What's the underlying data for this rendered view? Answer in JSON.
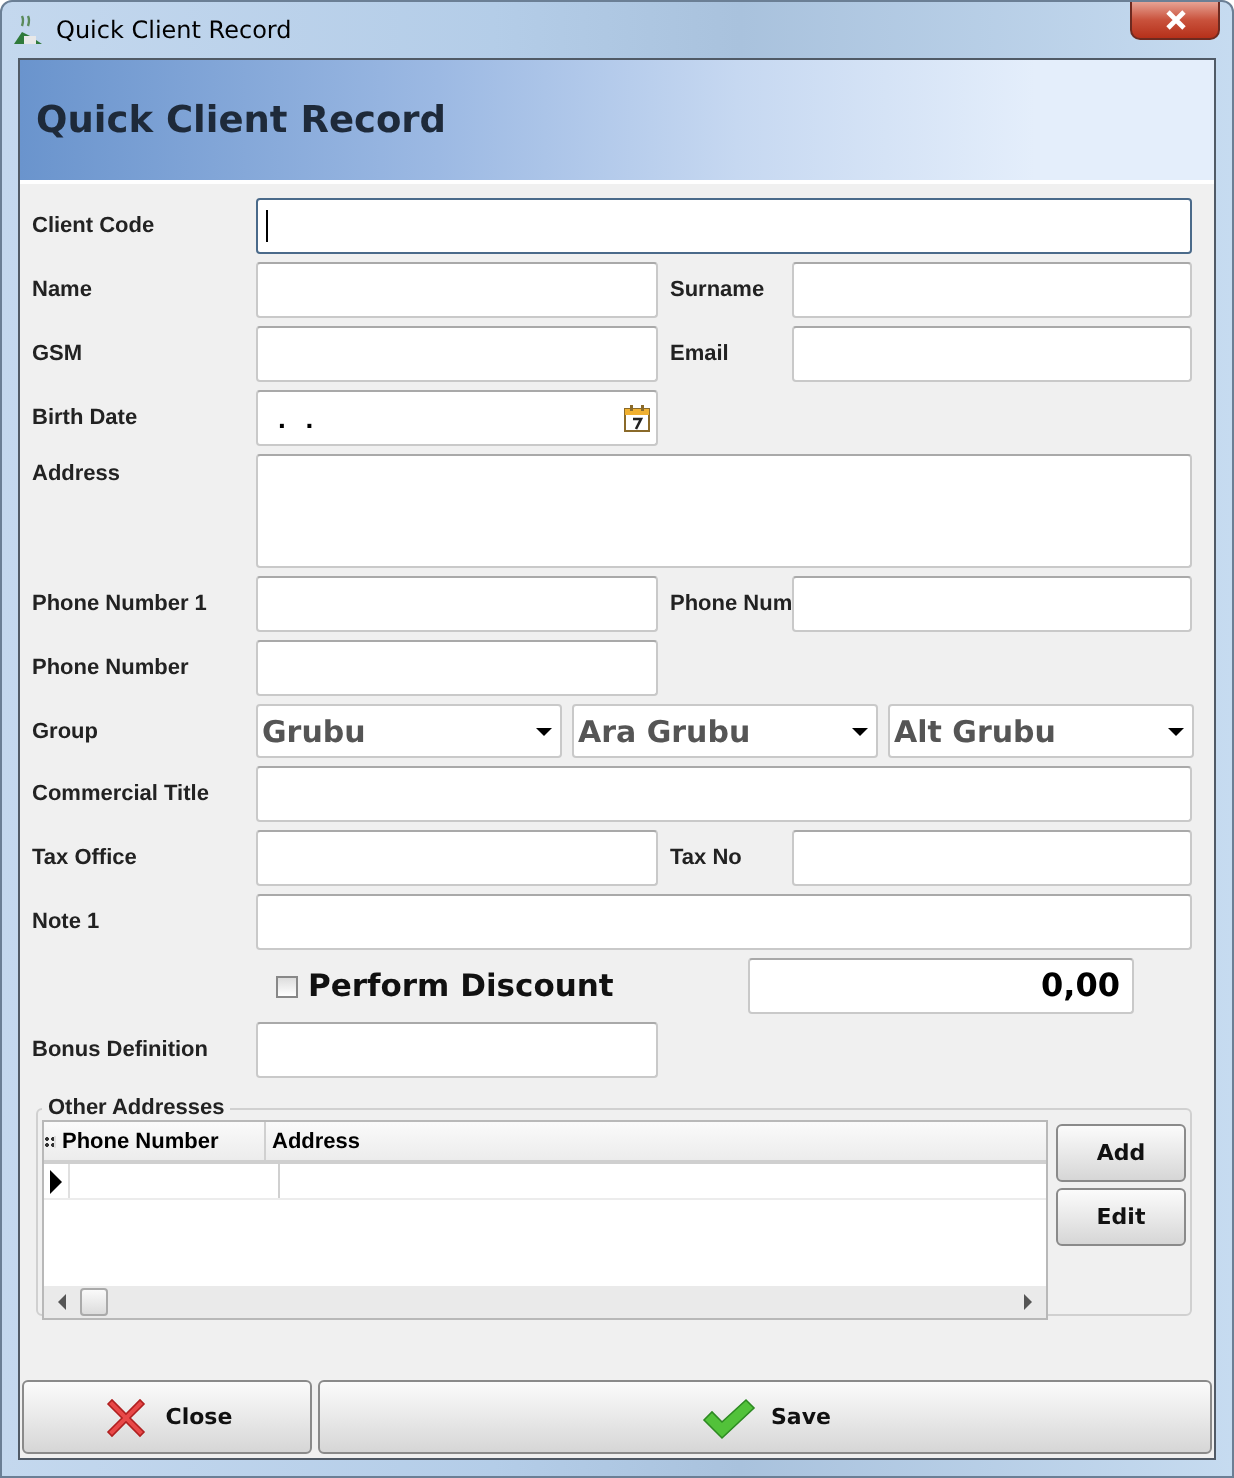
{
  "window": {
    "title": "Quick Client Record"
  },
  "header": {
    "title": "Quick Client Record"
  },
  "rows": [
    {
      "kind": "wide",
      "label": "Client Code",
      "focused": true
    },
    {
      "kind": "pair",
      "label": "Name",
      "label_2": "Surname"
    },
    {
      "kind": "pair",
      "label": "GSM",
      "label_2": "Email"
    },
    {
      "kind": "date",
      "label": "Birth Date",
      "value": ". ."
    },
    {
      "kind": "area",
      "label": "Address"
    },
    {
      "kind": "pair",
      "label": "Phone Number 1",
      "label_2": "Phone Num"
    },
    {
      "kind": "half",
      "label": "Phone Number"
    },
    {
      "kind": "combos",
      "label": "Group",
      "options": [
        "Grubu",
        "Ara Grubu",
        "Alt Grubu"
      ]
    },
    {
      "kind": "wide",
      "label": "Commercial Title",
      "focused": false
    },
    {
      "kind": "pair",
      "label": "Tax Office",
      "label_2": "Tax No"
    },
    {
      "kind": "wide",
      "label": "Note 1",
      "focused": false
    },
    {
      "kind": "discount",
      "label": "Perform Discount",
      "checked": false,
      "value": "0,00"
    },
    {
      "kind": "half",
      "label": "Bonus Definition"
    }
  ],
  "other_addresses": {
    "title": "Other Addresses",
    "columns": [
      "Phone Number",
      "Address"
    ],
    "rows": [
      {
        "current": true
      }
    ],
    "buttons": [
      "Add",
      "Edit"
    ]
  },
  "footer_buttons": [
    {
      "kind": "close",
      "label": "Close"
    },
    {
      "kind": "save",
      "label": "Save"
    }
  ]
}
